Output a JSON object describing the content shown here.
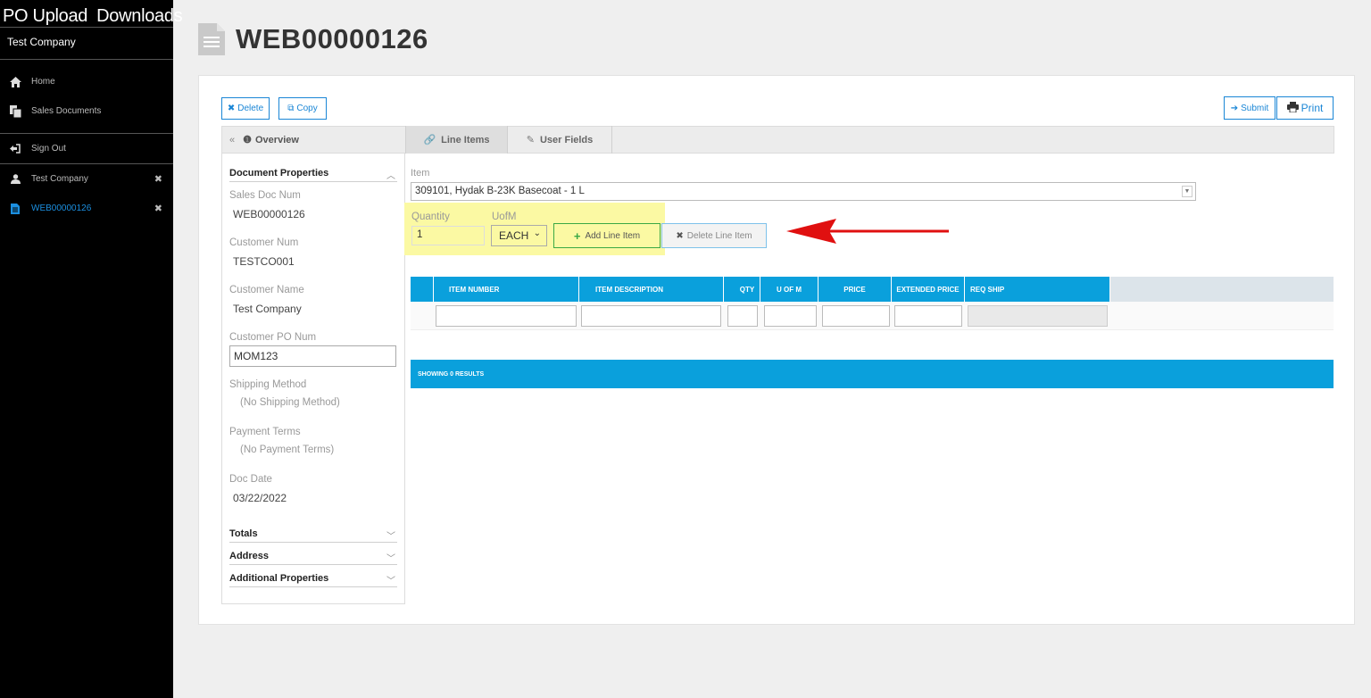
{
  "sidebar": {
    "brand": [
      "PO Upload",
      "Downloads"
    ],
    "company": "Test Company",
    "nav": [
      {
        "label": "Home",
        "icon": "home-icon"
      },
      {
        "label": "Sales Documents",
        "icon": "documents-icon"
      }
    ],
    "sign_out": "Sign Out",
    "open_items": [
      {
        "label": "Test Company",
        "icon": "user-icon",
        "active": false
      },
      {
        "label": "WEB00000126",
        "icon": "document-icon",
        "active": true
      }
    ]
  },
  "header": {
    "title": "WEB00000126"
  },
  "toolbar": {
    "delete_label": "Delete",
    "copy_label": "Copy",
    "submit_label": "Submit",
    "print_label": "Print"
  },
  "tabs": {
    "overview": "Overview",
    "line_items": "Line Items",
    "user_fields": "User Fields"
  },
  "properties": {
    "section_title": "Document Properties",
    "sales_doc_num_label": "Sales Doc Num",
    "sales_doc_num": "WEB00000126",
    "customer_num_label": "Customer Num",
    "customer_num": "TESTCO001",
    "customer_name_label": "Customer Name",
    "customer_name": "Test Company",
    "customer_po_label": "Customer PO Num",
    "customer_po": "MOM123",
    "shipping_label": "Shipping Method",
    "shipping": "(No Shipping Method)",
    "payment_label": "Payment Terms",
    "payment": "(No Payment Terms)",
    "doc_date_label": "Doc Date",
    "doc_date": "03/22/2022",
    "totals": "Totals",
    "address": "Address",
    "additional": "Additional Properties"
  },
  "line_entry": {
    "item_label": "Item",
    "item_value": "309101, Hydak B-23K Basecoat - 1 L",
    "quantity_label": "Quantity",
    "quantity": "1",
    "uofm_label": "UofM",
    "uofm": "EACH",
    "add_label": "Add Line Item",
    "delete_label": "Delete Line Item"
  },
  "grid": {
    "columns": [
      "ITEM NUMBER",
      "ITEM DESCRIPTION",
      "QTY",
      "U OF M",
      "PRICE",
      "EXTENDED PRICE",
      "REQ SHIP"
    ],
    "results": "SHOWING 0 RESULTS"
  },
  "colors": {
    "accent": "#0aa0dc",
    "link_blue": "#1a86d6",
    "highlight": "#fbf9a3",
    "arrow": "#e01010",
    "add_green": "#39a845"
  }
}
